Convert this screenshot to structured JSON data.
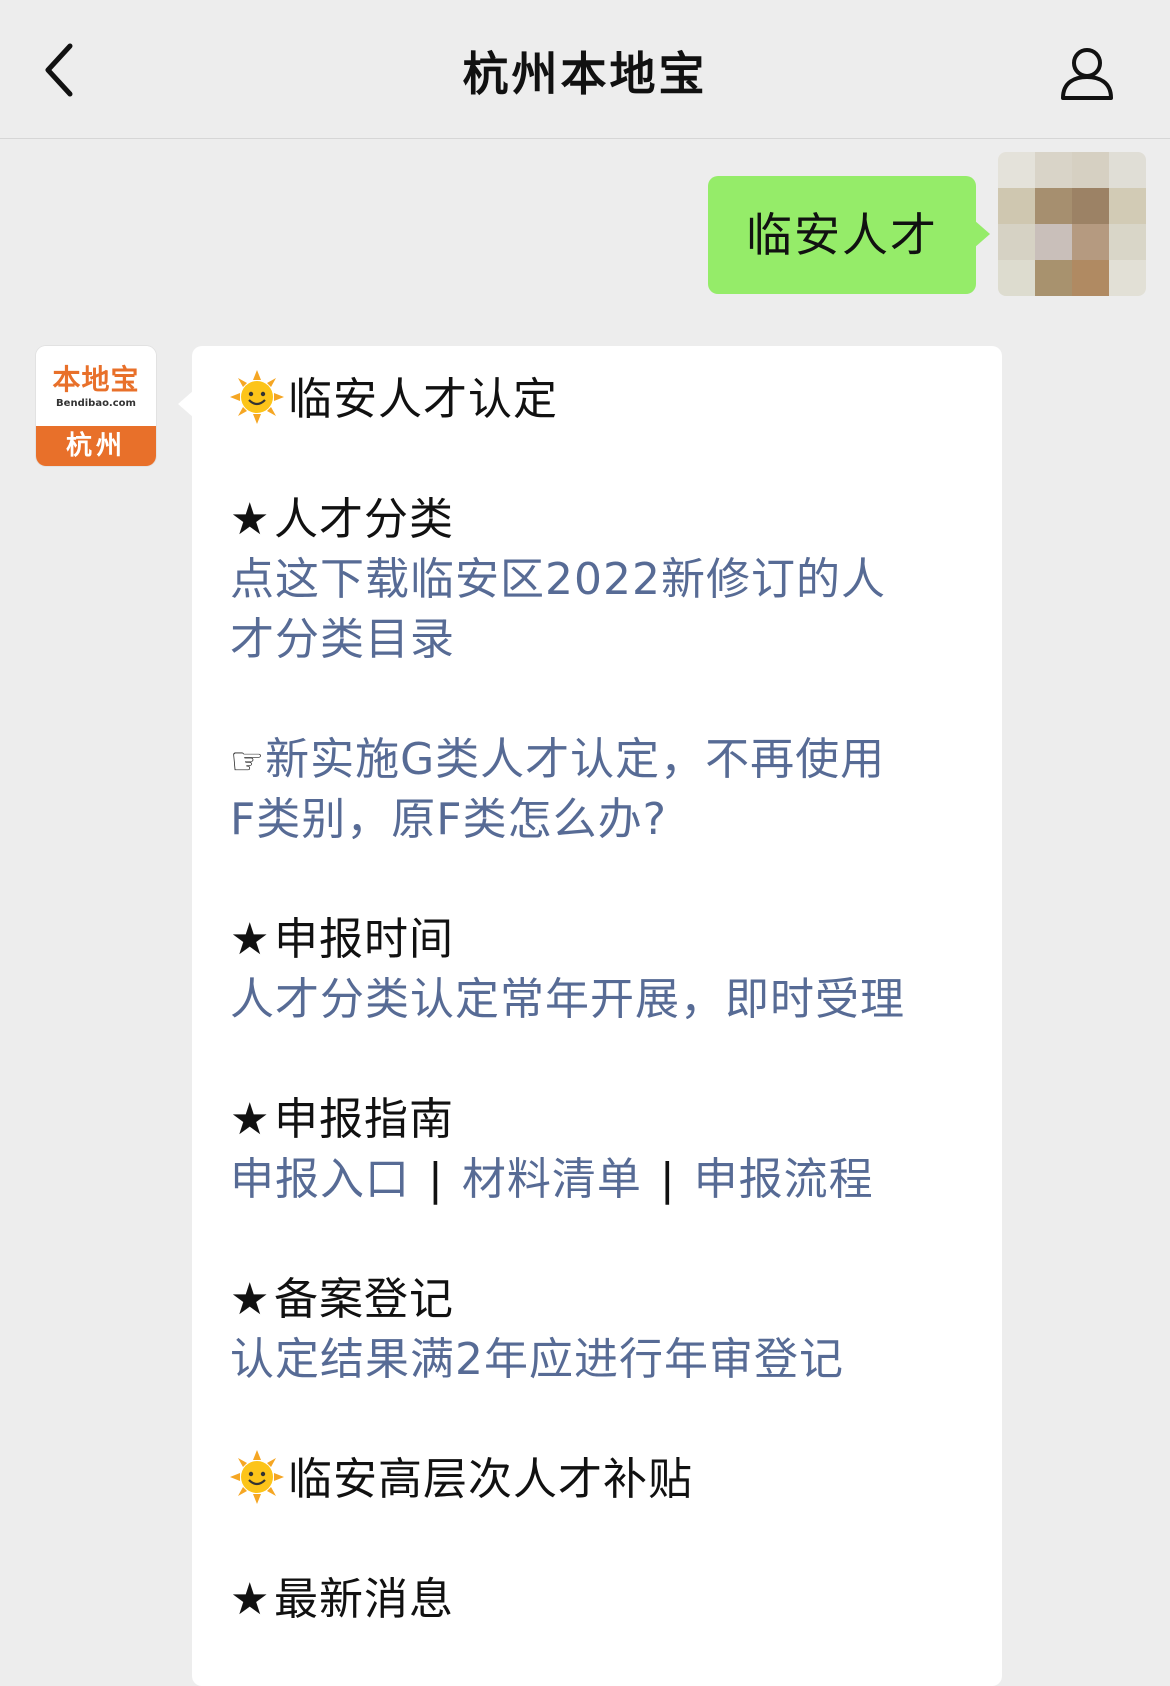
{
  "navbar": {
    "title": "杭州本地宝"
  },
  "user_message": {
    "text": "临安人才"
  },
  "bot_avatar": {
    "brand": "本地宝",
    "domain": "Bendibao.com",
    "city": "杭州"
  },
  "reply": {
    "section1_title": "临安人才认定",
    "star": "★",
    "hand": "☞",
    "talent_class_heading": "人才分类",
    "talent_class_link_line1": "点这下载临安区2022新修订的人",
    "talent_class_link_line2": "才分类目录",
    "g_class_link_line1": "新实施G类人才认定，不再使用",
    "g_class_link_line2": "F类别，原F类怎么办?",
    "time_heading": "申报时间",
    "time_link": "人才分类认定常年开展，即时受理",
    "guide_heading": "申报指南",
    "guide_entry": "申报入口",
    "guide_materials": "材料清单",
    "guide_process": "申报流程",
    "separator": "|",
    "record_heading": "备案登记",
    "record_link": "认定结果满2年应进行年审登记",
    "section2_title": "临安高层次人才补贴",
    "news_heading": "最新消息"
  }
}
